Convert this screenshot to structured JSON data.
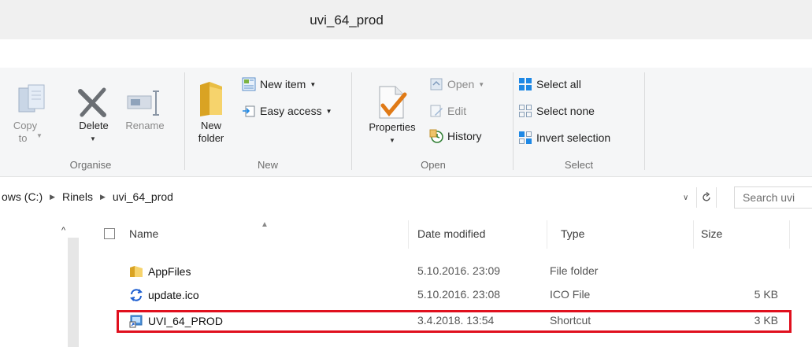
{
  "window": {
    "title": "uvi_64_prod"
  },
  "ribbon": {
    "organise": {
      "label": "Organise",
      "copy_to": {
        "line1": "Copy",
        "line2": "to"
      },
      "delete": "Delete",
      "rename": "Rename"
    },
    "new": {
      "label": "New",
      "new_folder": {
        "line1": "New",
        "line2": "folder"
      },
      "new_item": "New item",
      "easy_access": "Easy access"
    },
    "open": {
      "label": "Open",
      "properties": "Properties",
      "open": "Open",
      "edit": "Edit",
      "history": "History"
    },
    "select": {
      "label": "Select",
      "select_all": "Select all",
      "select_none": "Select none",
      "invert_selection": "Invert selection"
    }
  },
  "address": {
    "crumbs": [
      "ows (C:)",
      "Rinels",
      "uvi_64_prod"
    ],
    "search_placeholder": "Search uvi"
  },
  "list": {
    "columns": {
      "name": "Name",
      "date": "Date modified",
      "type": "Type",
      "size": "Size"
    },
    "rows": [
      {
        "name": "AppFiles",
        "date": "5.10.2016. 23:09",
        "type": "File folder",
        "size": "",
        "icon": "folder-icon"
      },
      {
        "name": "update.ico",
        "date": "5.10.2016. 23:08",
        "type": "ICO File",
        "size": "5 KB",
        "icon": "refresh-arrows-icon"
      },
      {
        "name": "UVI_64_PROD",
        "date": "3.4.2018. 13:54",
        "type": "Shortcut",
        "size": "3 KB",
        "icon": "shortcut-icon"
      }
    ]
  },
  "colors": {
    "highlight": "#e0101e",
    "accent": "#1e88e5"
  }
}
